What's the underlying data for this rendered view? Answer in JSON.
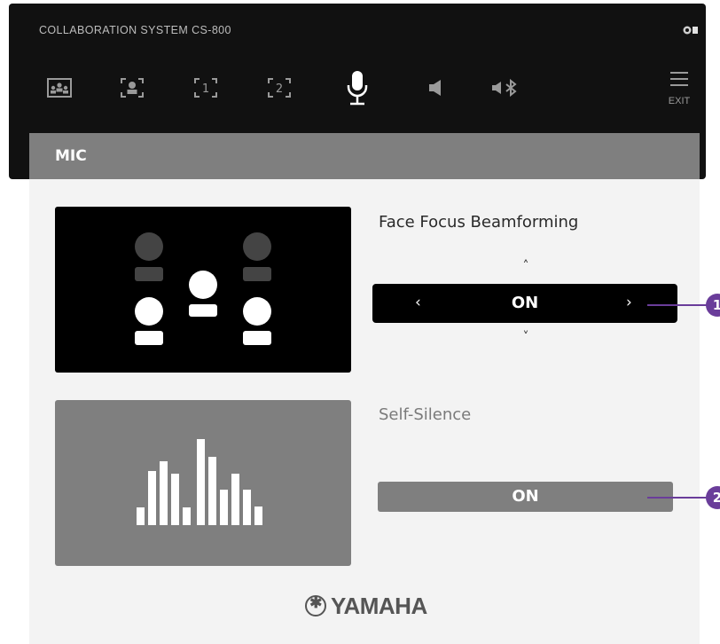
{
  "topbar": {
    "system_title": "COLLABORATION SYSTEM CS-800",
    "tabs": [
      {
        "icon": "group-framing-icon"
      },
      {
        "icon": "speaker-framing-icon"
      },
      {
        "icon": "preset-1-icon",
        "label": "1"
      },
      {
        "icon": "preset-2-icon",
        "label": "2"
      },
      {
        "icon": "microphone-icon",
        "selected": true
      },
      {
        "icon": "speaker-volume-icon"
      },
      {
        "icon": "bluetooth-volume-icon"
      }
    ],
    "exit_label": "EXIT"
  },
  "panel": {
    "title": "MIC",
    "face_focus": {
      "label": "Face Focus Beamforming",
      "value": "ON",
      "prev": "‹",
      "next": "›",
      "up": "˄",
      "down": "˅"
    },
    "self_silence": {
      "label": "Self-Silence",
      "value": "ON"
    },
    "brand": "YAMAHA"
  },
  "callouts": [
    "1",
    "2"
  ],
  "colors": {
    "topbar_bg": "#111111",
    "panel_header": "#7f7f7f",
    "panel_bg": "#f3f3f3",
    "callout": "#6a3d9a"
  }
}
